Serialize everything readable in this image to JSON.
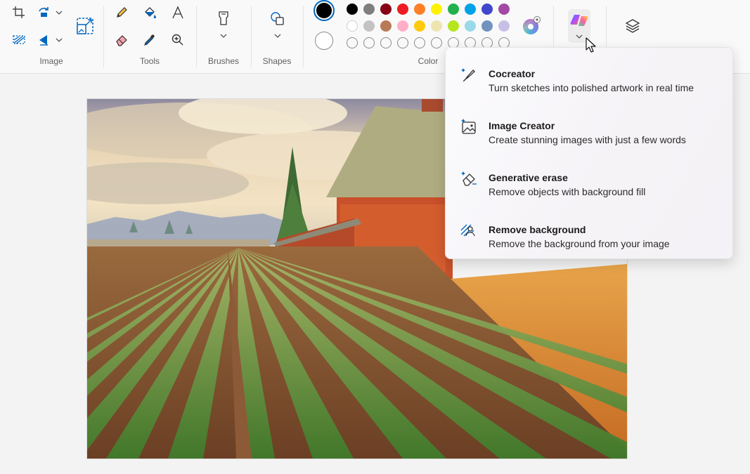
{
  "toolbar": {
    "groups": {
      "image": "Image",
      "tools": "Tools",
      "brushes": "Brushes",
      "shapes": "Shapes",
      "color": "Color"
    },
    "icons": {
      "image": [
        "crop-icon",
        "rotate-icon",
        "resize-icon",
        "select-icon",
        "flip-icon"
      ],
      "tools": [
        "pencil-icon",
        "fill-icon",
        "text-icon",
        "eraser-icon",
        "color-picker-icon",
        "magnifier-icon"
      ],
      "brushes": "brush-icon",
      "shapes": "shapes-icon",
      "copilot": "copilot-icon",
      "layers": "layers-icon"
    }
  },
  "colors": {
    "primary": "#000000",
    "secondary": "#ffffff",
    "row1": [
      "#000000",
      "#7f7f7f",
      "#880015",
      "#ed1c24",
      "#ff7f27",
      "#fff200",
      "#22b14c",
      "#00a2e8",
      "#3f48cc",
      "#a349a4"
    ],
    "row2": [
      "#ffffff",
      "#c3c3c3",
      "#b97a57",
      "#ffaec9",
      "#ffc90e",
      "#efe4b0",
      "#b5e61d",
      "#99d9ea",
      "#7092be",
      "#c8bfe7"
    ],
    "row3_count": 10
  },
  "menu": {
    "items": [
      {
        "id": "cocreator",
        "icon": "cocreator-icon",
        "title": "Cocreator",
        "desc": "Turn sketches into polished artwork in real time"
      },
      {
        "id": "image-creator",
        "icon": "image-creator-icon",
        "title": "Image Creator",
        "desc": "Create stunning images with just a few words"
      },
      {
        "id": "generative-erase",
        "icon": "generative-erase-icon",
        "title": "Generative erase",
        "desc": "Remove objects with background fill"
      },
      {
        "id": "remove-background",
        "icon": "remove-background-icon",
        "title": "Remove background",
        "desc": "Remove the background from your image"
      }
    ]
  },
  "accent": "#0067c0"
}
